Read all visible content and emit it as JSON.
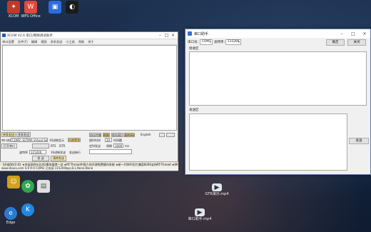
{
  "desktop": {
    "icons_top": [
      {
        "label": "XCOM",
        "color": "#c0392b"
      },
      {
        "label": "WPS Office",
        "color": "#e2483d"
      },
      {
        "label": "",
        "color": "#2d6cdf"
      },
      {
        "label": "",
        "color": "#1b1b1b"
      }
    ],
    "icons_left": [
      {
        "label": "",
        "color": "#d4a017"
      },
      {
        "label": "",
        "color": "#2fa84f"
      },
      {
        "label": "",
        "color": "#e0e0e0"
      },
      {
        "label": "",
        "color": "#1e88e5"
      },
      {
        "label": "Edge",
        "color": "#2b7ad1"
      }
    ],
    "file_icons": [
      {
        "label": "GTR演示.mp4"
      },
      {
        "label": "串口助手.mp4"
      }
    ]
  },
  "left_app": {
    "title": "XCOM V2.6 串口/网络调试助手",
    "menu": [
      "串口设置",
      "文件(F)",
      "编辑",
      "视图",
      "多条发送",
      "小工具",
      "帮助",
      "关于"
    ],
    "buttons": {
      "single_send": "单条发送",
      "multi_send": "多条发送",
      "protocol": "协议传输",
      "help": "帮助",
      "save_window": "保存窗口",
      "clear_recv": "清除接收",
      "open_port": "打开串口",
      "send": "发 送",
      "clear_send": "清除发送"
    },
    "labels": {
      "port_label": "串口选择",
      "port_value": "COM2: ELTIMA Virtual Serial",
      "baud_label": "波特率",
      "baud_value": "115200",
      "hex_display": "16进制显示",
      "white_bg": "白底黑字",
      "rts": "RTS",
      "dtr": "DTR",
      "timestamp": "时间戳",
      "timeout": "超时时间",
      "timeout_value": "20",
      "ms": "ms",
      "timed_send": "定时发送",
      "period": "周期",
      "period_value": "1000",
      "hex_send": "16进制发送",
      "newline": "发送新行",
      "english": "English"
    },
    "status": "www.daxia.com   S:0   R:0   COM2 已关闭  115200bps,8,1,None,None",
    "ticker": "【升级到V2.6】★合宙高性价比4G模块值得一试 ★RT-Thread中国人的开源免费操作系统 ★新一代WiFi芯片兼容8266支持RT-Thread ★8KM远距离WiFi可自组网"
  },
  "right_app": {
    "title": "串口助手",
    "port_label": "串口号：",
    "port_value": "COM1",
    "baud_label": "波特率：",
    "baud_value": "115200",
    "confirm_button": "确定",
    "close_button": "关闭",
    "recv_label": "接收区",
    "send_label": "发送区",
    "send_button": "发送"
  }
}
